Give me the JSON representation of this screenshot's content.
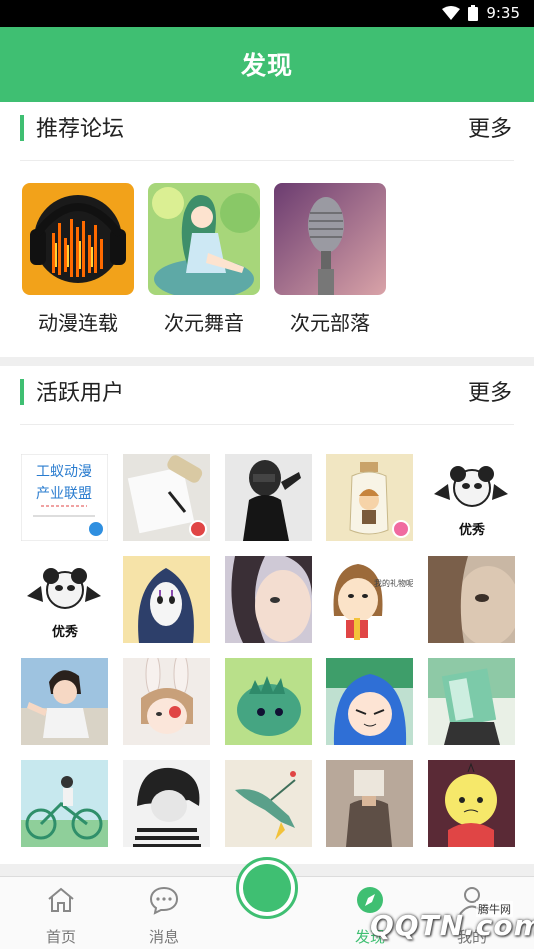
{
  "status_bar": {
    "time": "9:35"
  },
  "app_bar": {
    "title": "发现"
  },
  "forums_section": {
    "title": "推荐论坛",
    "more_label": "更多",
    "forums": [
      {
        "label": "动漫连载"
      },
      {
        "label": "次元舞音"
      },
      {
        "label": "次元部落"
      }
    ]
  },
  "users_section": {
    "title": "活跃用户",
    "more_label": "更多",
    "user_tile_text": {
      "card_line1": "工蚁动漫",
      "card_line2": "产业联盟",
      "panda_caption": "优秀",
      "speech_bubble": "我的礼物呢？"
    }
  },
  "tab_bar": {
    "tabs": [
      {
        "label": "首页"
      },
      {
        "label": "消息"
      },
      {
        "label": "发现"
      },
      {
        "label": "我的"
      }
    ]
  },
  "watermark": {
    "text": "QQTN.com",
    "small_text": "腾牛网"
  },
  "colors": {
    "accent": "#3fbf72",
    "verified_badge": "#2f8fe0",
    "red_badge": "#e04545",
    "pink_badge": "#f06aa0"
  }
}
